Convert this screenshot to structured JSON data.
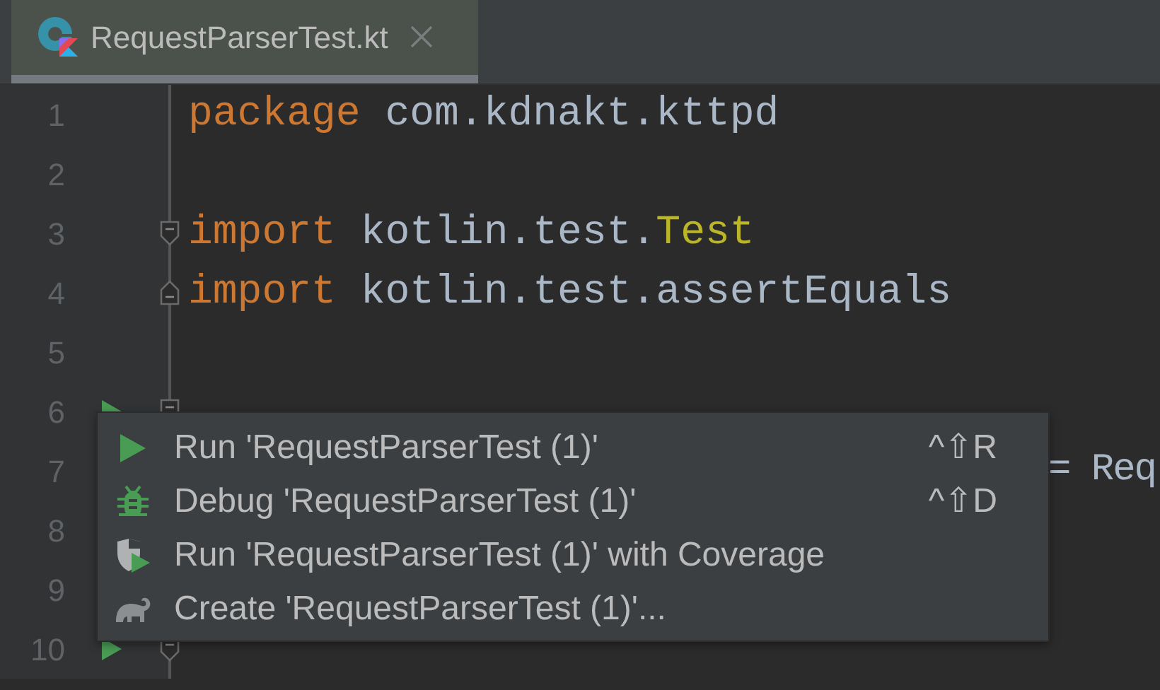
{
  "tab": {
    "title": "RequestParserTest.kt",
    "selected": true
  },
  "lines": [
    {
      "number": "1",
      "run_marker": false,
      "fold_start": false,
      "fold_end": false,
      "tokens": [
        {
          "text": "package",
          "kind": "keyword"
        },
        {
          "text": " com.kdnakt.kttpd",
          "kind": "plain"
        }
      ]
    },
    {
      "number": "2",
      "run_marker": false,
      "fold_start": false,
      "fold_end": false
    },
    {
      "number": "3",
      "run_marker": false,
      "fold_start": true,
      "fold_end": false,
      "tokens": [
        {
          "text": "import",
          "kind": "keyword"
        },
        {
          "text": " kotlin.test.",
          "kind": "plain"
        },
        {
          "text": "Test",
          "kind": "annotation"
        }
      ]
    },
    {
      "number": "4",
      "run_marker": false,
      "fold_start": false,
      "fold_end": true,
      "tokens": [
        {
          "text": "import",
          "kind": "keyword"
        },
        {
          "text": " kotlin.test.assertEquals",
          "kind": "plain"
        }
      ]
    },
    {
      "number": "5",
      "run_marker": false,
      "fold_start": false,
      "fold_end": false
    },
    {
      "number": "6",
      "run_marker": true,
      "fold_start": true,
      "fold_end": false
    },
    {
      "number": "7",
      "run_marker": false,
      "fold_start": false,
      "fold_end": false,
      "tokens": [
        {
          "text": "= Req",
          "kind": "far"
        }
      ]
    },
    {
      "number": "8",
      "run_marker": false,
      "fold_start": false,
      "fold_end": false
    },
    {
      "number": "9",
      "run_marker": false,
      "fold_start": false,
      "fold_end": false
    },
    {
      "number": "10",
      "run_marker": true,
      "fold_start": true,
      "fold_end": false
    }
  ],
  "popup": {
    "items": [
      {
        "kind": "run",
        "label": "Run 'RequestParserTest (1)'",
        "shortcut": "^⇧R"
      },
      {
        "kind": "debug",
        "label": "Debug 'RequestParserTest (1)'",
        "shortcut": "^⇧D"
      },
      {
        "kind": "coverage",
        "label": "Run 'RequestParserTest (1)' with Coverage"
      },
      {
        "kind": "create",
        "label": "Create 'RequestParserTest (1)'..."
      }
    ]
  }
}
